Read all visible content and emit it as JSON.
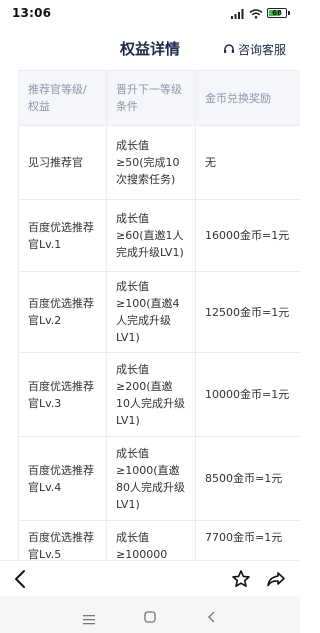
{
  "status": {
    "time": "13:06",
    "battery": "68"
  },
  "header": {
    "title": "权益详情",
    "support_label": "咨询客服"
  },
  "table": {
    "headers": [
      "推荐官等级/权益",
      "晋升下一等级条件",
      "金币兑换奖励"
    ],
    "rows": [
      [
        "见习推荐官",
        "成长值≥50(完成10次搜索任务)",
        "无"
      ],
      [
        "百度优选推荐官Lv.1",
        "成长值≥60(直邀1人完成升级LV1)",
        "16000金币=1元"
      ],
      [
        "百度优选推荐官Lv.2",
        "成长值≥100(直邀4人完成升级LV1)",
        "12500金币=1元"
      ],
      [
        "百度优选推荐官Lv.3",
        "成长值≥200(直邀10人完成升级LV1)",
        "10000金币=1元"
      ],
      [
        "百度优选推荐官Lv.4",
        "成长值≥1000(直邀80人完成升级LV1)",
        "8500金币=1元"
      ],
      [
        "百度优选推荐官Lv.5",
        "成长值≥100000",
        "7700金币=1元"
      ]
    ]
  }
}
